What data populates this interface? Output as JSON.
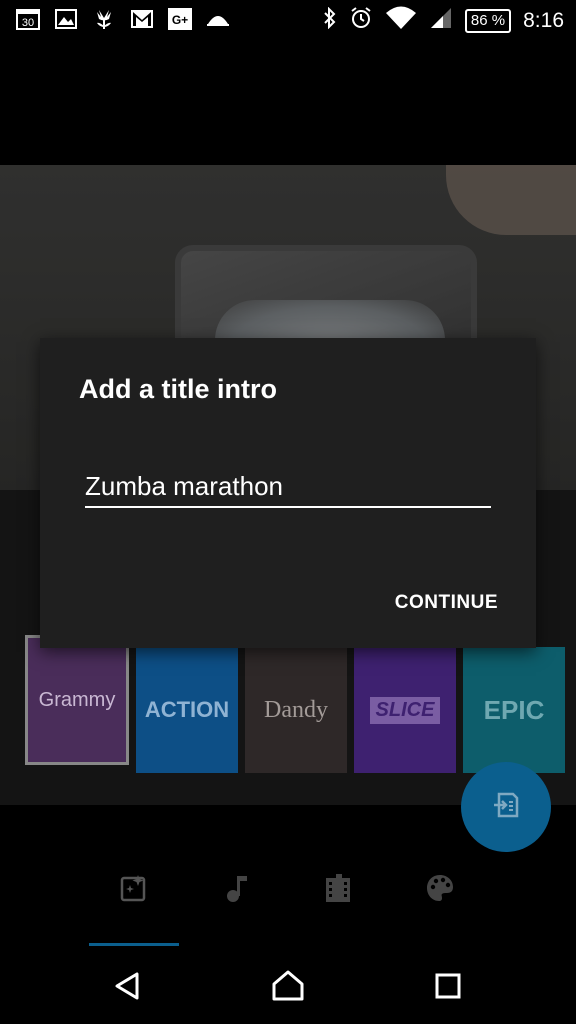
{
  "status_bar": {
    "left_icons": [
      "calendar-icon",
      "photo-icon",
      "tulip-icon",
      "gmail-icon",
      "google-plus-icon",
      "dome-icon"
    ],
    "calendar_day": "30",
    "gplus_label": "G+",
    "right_icons": [
      "bluetooth-icon",
      "alarm-icon",
      "wifi-icon",
      "signal-icon"
    ],
    "battery": "86 %",
    "time": "8:16"
  },
  "dialog": {
    "title": "Add a title intro",
    "input_value": "Zumba marathon",
    "continue_label": "CONTINUE"
  },
  "themes": [
    {
      "label": "Grammy",
      "bg": "#4a2d5a",
      "color": "#c9b8d3",
      "selected": true
    },
    {
      "label": "ACTION",
      "bg": "#0d4f86",
      "color": "#8fb3d3",
      "selected": false
    },
    {
      "label": "Dandy",
      "bg": "#2e2828",
      "color": "#a39b98",
      "selected": false
    },
    {
      "label": "SLICE",
      "bg": "#3e2170",
      "color": "#7a5da3",
      "selected": false
    },
    {
      "label": "EPIC",
      "bg": "#0d5d6b",
      "color": "#6fa8b1",
      "selected": false
    }
  ],
  "fab": {
    "icon": "export-icon",
    "color": "#0b5f8e"
  },
  "bottom_nav": [
    "title-sparkle-icon",
    "music-note-icon",
    "film-icon",
    "palette-icon"
  ],
  "system_nav": [
    "back-icon",
    "home-icon",
    "recents-icon"
  ],
  "colors": {
    "accent": "#0b5f8e",
    "dialog_bg": "#1f1f1f"
  }
}
